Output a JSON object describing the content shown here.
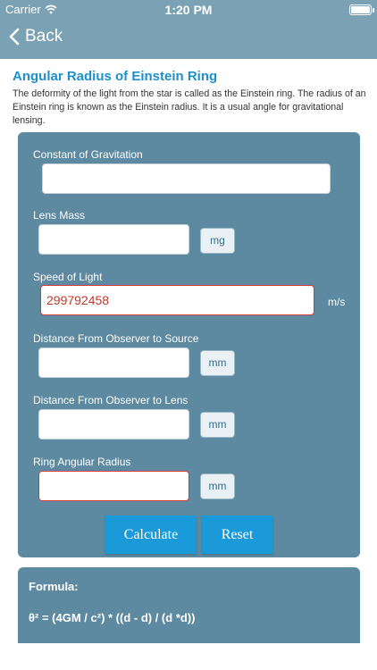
{
  "status": {
    "carrier": "Carrier",
    "time": "1:20 PM"
  },
  "nav": {
    "back_label": "Back"
  },
  "page": {
    "title": "Angular Radius of Einstein Ring",
    "description": "The deformity of the light from the star is called as the Einstein ring. The radius of an Einstein ring is known as the Einstein radius. It is a usual angle for gravitational lensing."
  },
  "form": {
    "gravitation": {
      "label": "Constant of Gravitation",
      "value": ""
    },
    "lens_mass": {
      "label": "Lens Mass",
      "value": "",
      "unit": "mg"
    },
    "light_speed": {
      "label": "Speed of Light",
      "value": "299792458",
      "unit": "m/s"
    },
    "observer_source": {
      "label": "Distance From Observer to Source",
      "value": "",
      "unit": "mm"
    },
    "observer_lens": {
      "label": "Distance From Observer to Lens",
      "value": "",
      "unit": "mm"
    },
    "ring_radius": {
      "label": "Ring Angular Radius",
      "value": "",
      "unit": "mm"
    }
  },
  "buttons": {
    "calculate": "Calculate",
    "reset": "Reset"
  },
  "formula": {
    "label": "Formula:",
    "text": "θ² = (4GM / c²) * ((d - d) / (d *d))"
  },
  "colors": {
    "navbar": "#7ba1b4",
    "panel": "#5d8aa0",
    "accent": "#1a9ad9",
    "title": "#1e8fc9",
    "error": "#d43a3a"
  }
}
